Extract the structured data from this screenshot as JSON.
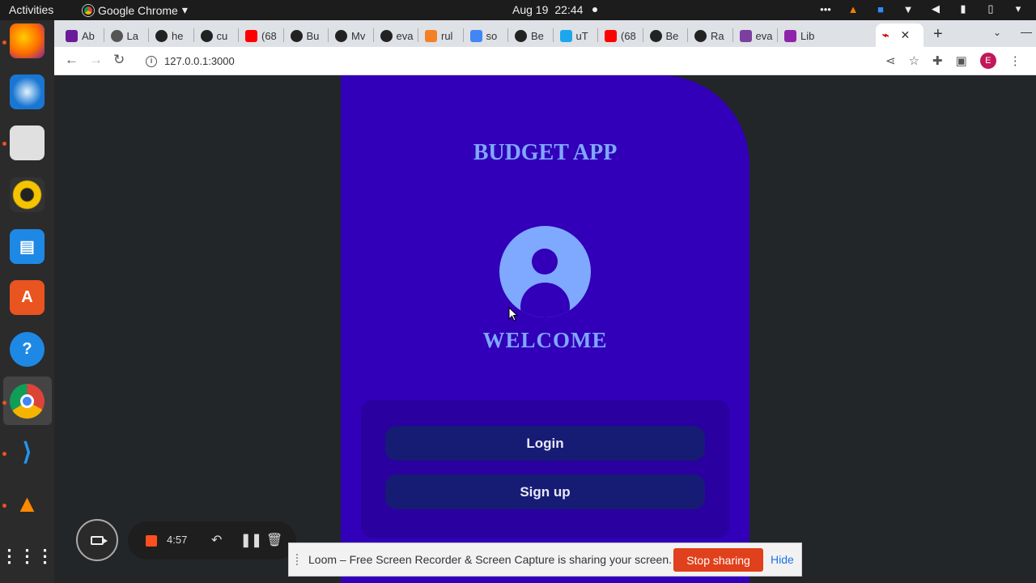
{
  "topbar": {
    "activities": "Activities",
    "app_menu": "Google Chrome",
    "date": "Aug 19",
    "time": "22:44"
  },
  "dock": {
    "items": [
      "firefox-icon",
      "thunderbird-icon",
      "files-icon",
      "rhythmbox-icon",
      "writer-icon",
      "app-center-icon",
      "help-icon",
      "chrome-icon",
      "vscode-icon",
      "vlc-icon",
      "app-grid-icon"
    ]
  },
  "tabs": [
    {
      "label": "Ab",
      "icon": "site-icon",
      "color": "#6a1b9a"
    },
    {
      "label": "La",
      "icon": "globe-icon",
      "color": "#555555"
    },
    {
      "label": "he",
      "icon": "github-icon",
      "color": "#222222"
    },
    {
      "label": "cu",
      "icon": "github-icon",
      "color": "#222222"
    },
    {
      "label": "(68",
      "icon": "youtube-icon",
      "color": "#ff0000"
    },
    {
      "label": "Bu",
      "icon": "github-icon",
      "color": "#222222"
    },
    {
      "label": "Mv",
      "icon": "github-icon",
      "color": "#222222"
    },
    {
      "label": "eva",
      "icon": "github-icon",
      "color": "#222222"
    },
    {
      "label": "rul",
      "icon": "stackoverflow-icon",
      "color": "#f48024"
    },
    {
      "label": "so",
      "icon": "google-icon",
      "color": "#4285f4"
    },
    {
      "label": "Be",
      "icon": "github-icon",
      "color": "#222222"
    },
    {
      "label": "uT",
      "icon": "site-icon",
      "color": "#1ca7ec"
    },
    {
      "label": "(68",
      "icon": "youtube-icon",
      "color": "#ff0000"
    },
    {
      "label": "Be",
      "icon": "github-icon",
      "color": "#222222"
    },
    {
      "label": "Ra",
      "icon": "github-icon",
      "color": "#222222"
    },
    {
      "label": "eva",
      "icon": "site-icon",
      "color": "#7b3fa0"
    },
    {
      "label": "Lib",
      "icon": "site-icon",
      "color": "#8e24aa"
    }
  ],
  "browser": {
    "url": "127.0.0.1:3000",
    "profile_initial": "E"
  },
  "app": {
    "title": "BUDGET APP",
    "welcome": "WELCOME",
    "login_label": "Login",
    "signup_label": "Sign up",
    "colors": {
      "background": "#3100b8",
      "accent": "#7fa8ff",
      "button": "#161b74"
    }
  },
  "loom": {
    "timer": "4:57",
    "banner_text": "Loom – Free Screen Recorder & Screen Capture is sharing your screen.",
    "stop_label": "Stop sharing",
    "hide_label": "Hide"
  }
}
